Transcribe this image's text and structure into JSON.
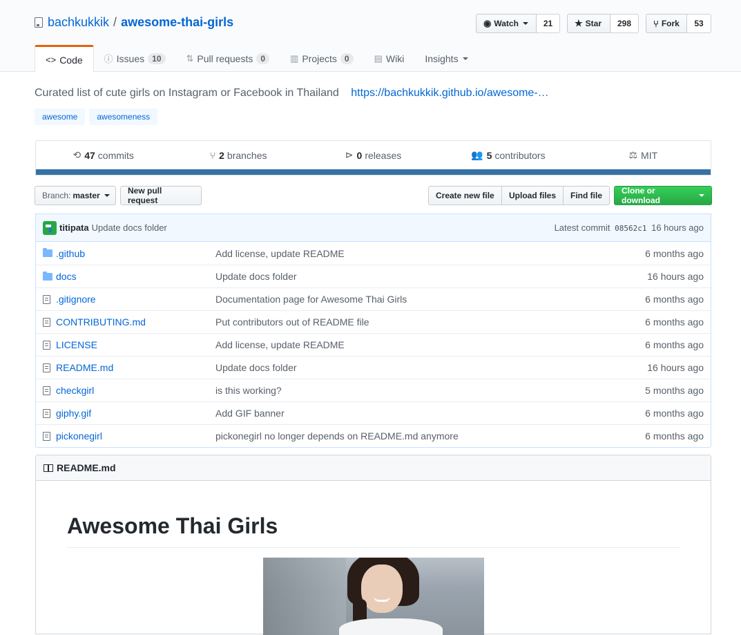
{
  "repo": {
    "owner": "bachkukkik",
    "separator": "/",
    "name": "awesome-thai-girls"
  },
  "actions": {
    "watch": {
      "label": "Watch",
      "count": "21"
    },
    "star": {
      "label": "Star",
      "count": "298"
    },
    "fork": {
      "label": "Fork",
      "count": "53"
    }
  },
  "reponav": {
    "code": "Code",
    "issues": {
      "label": "Issues",
      "count": "10"
    },
    "pulls": {
      "label": "Pull requests",
      "count": "0"
    },
    "projects": {
      "label": "Projects",
      "count": "0"
    },
    "wiki": "Wiki",
    "insights": "Insights"
  },
  "description": {
    "text": "Curated list of cute girls on Instagram or Facebook in Thailand",
    "link": "https://bachkukkik.github.io/awesome-…"
  },
  "topics": [
    "awesome",
    "awesomeness"
  ],
  "summary": {
    "commits": {
      "count": "47",
      "label": "commits"
    },
    "branches": {
      "count": "2",
      "label": "branches"
    },
    "releases": {
      "count": "0",
      "label": "releases"
    },
    "contributors": {
      "count": "5",
      "label": "contributors"
    },
    "license": "MIT"
  },
  "colors": {
    "langbar": "#3572A5",
    "accent": "#0366d6",
    "primary_button": "#28a745",
    "nav_selected_border": "#e36209"
  },
  "filenav": {
    "branch_prefix": "Branch:",
    "branch_name": "master",
    "new_pr": "New pull request",
    "create_file": "Create new file",
    "upload": "Upload files",
    "find": "Find file",
    "clone": "Clone or download"
  },
  "commit": {
    "author": "titipata",
    "message": "Update docs folder",
    "latest_label": "Latest commit",
    "sha": "08562c1",
    "age": "16 hours ago"
  },
  "files": [
    {
      "type": "folder",
      "name": ".github",
      "message": "Add license, update README",
      "age": "6 months ago"
    },
    {
      "type": "folder",
      "name": "docs",
      "message": "Update docs folder",
      "age": "16 hours ago"
    },
    {
      "type": "file",
      "name": ".gitignore",
      "message": "Documentation page for Awesome Thai Girls",
      "age": "6 months ago"
    },
    {
      "type": "file",
      "name": "CONTRIBUTING.md",
      "message": "Put contributors out of README file",
      "age": "6 months ago"
    },
    {
      "type": "file",
      "name": "LICENSE",
      "message": "Add license, update README",
      "age": "6 months ago"
    },
    {
      "type": "file",
      "name": "README.md",
      "message": "Update docs folder",
      "age": "16 hours ago"
    },
    {
      "type": "file",
      "name": "checkgirl",
      "message": "is this working?",
      "age": "5 months ago"
    },
    {
      "type": "file",
      "name": "giphy.gif",
      "message": "Add GIF banner",
      "age": "6 months ago"
    },
    {
      "type": "file",
      "name": "pickonegirl",
      "message": "pickonegirl no longer depends on README.md anymore",
      "age": "6 months ago"
    }
  ],
  "readme": {
    "filename": "README.md",
    "heading": "Awesome Thai Girls"
  }
}
